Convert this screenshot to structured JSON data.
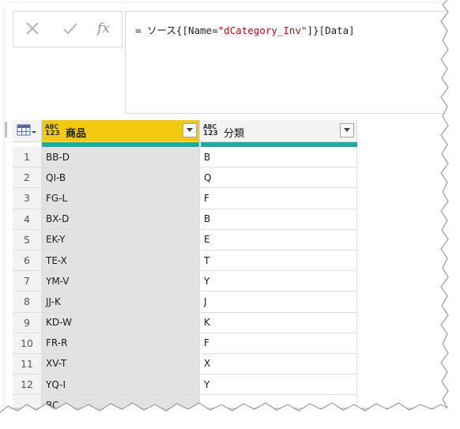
{
  "formula_bar": {
    "cancel_icon": "x-icon",
    "commit_icon": "check-icon",
    "fx_label": "fx",
    "formula_prefix": "= ソース{[Name=",
    "formula_string": "\"dCategory_Inv\"",
    "formula_suffix": "]}[Data]"
  },
  "table": {
    "columns": [
      {
        "type_label_top": "ABC",
        "type_label_bottom": "123",
        "name": "商品",
        "selected": true
      },
      {
        "type_label_top": "ABC",
        "type_label_bottom": "123",
        "name": "分類",
        "selected": false
      }
    ],
    "rows": [
      {
        "index": "1",
        "product": "BB-D",
        "category": "B"
      },
      {
        "index": "2",
        "product": "QI-B",
        "category": "Q"
      },
      {
        "index": "3",
        "product": "FG-L",
        "category": "F"
      },
      {
        "index": "4",
        "product": "BX-D",
        "category": "B"
      },
      {
        "index": "5",
        "product": "EK-Y",
        "category": "E"
      },
      {
        "index": "6",
        "product": "TE-X",
        "category": "T"
      },
      {
        "index": "7",
        "product": "YM-V",
        "category": "Y"
      },
      {
        "index": "8",
        "product": "JJ-K",
        "category": "J"
      },
      {
        "index": "9",
        "product": "KD-W",
        "category": "K"
      },
      {
        "index": "10",
        "product": "FR-R",
        "category": "F"
      },
      {
        "index": "11",
        "product": "XV-T",
        "category": "X"
      },
      {
        "index": "12",
        "product": "YQ-I",
        "category": "Y"
      },
      {
        "index": "",
        "product": "BC",
        "category": ""
      }
    ]
  },
  "colors": {
    "selected_header": "#f2c811",
    "quality_bar": "#1aaca0",
    "selected_column_bg": "#e2e2e2"
  }
}
